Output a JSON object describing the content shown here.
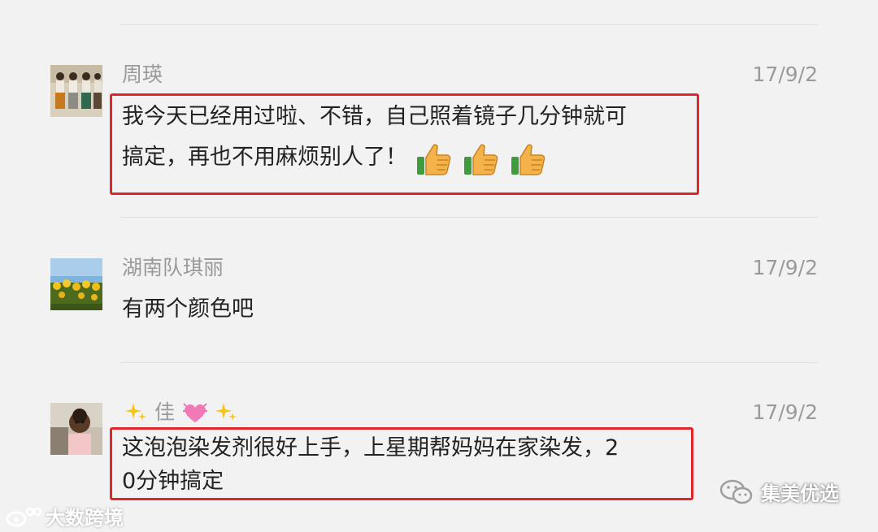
{
  "comments": [
    {
      "name": "周瑛",
      "date": "17/9/2",
      "lines": [
        "我今天已经用过啦、不错，自己照着镜子几分钟就可",
        "搞定，再也不用麻烦别人了！"
      ],
      "reactions": [
        "thumbs-up-icon",
        "thumbs-up-icon",
        "thumbs-up-icon"
      ]
    },
    {
      "name": "湖南队琪丽",
      "date": "17/9/2",
      "lines": [
        "有两个颜色吧"
      ]
    },
    {
      "name_parts": [
        "佳"
      ],
      "date": "17/9/2",
      "lines": [
        "这泡泡染发剂很好上手，上星期帮妈妈在家染发，2",
        "0分钟搞定"
      ]
    }
  ],
  "watermarks": {
    "left": "大数跨境",
    "right": "集美优选"
  },
  "colors": {
    "highlight": "#e0262b",
    "meta_text": "#9a9a9a",
    "body_text": "#222222",
    "background": "#f2f2f2"
  }
}
